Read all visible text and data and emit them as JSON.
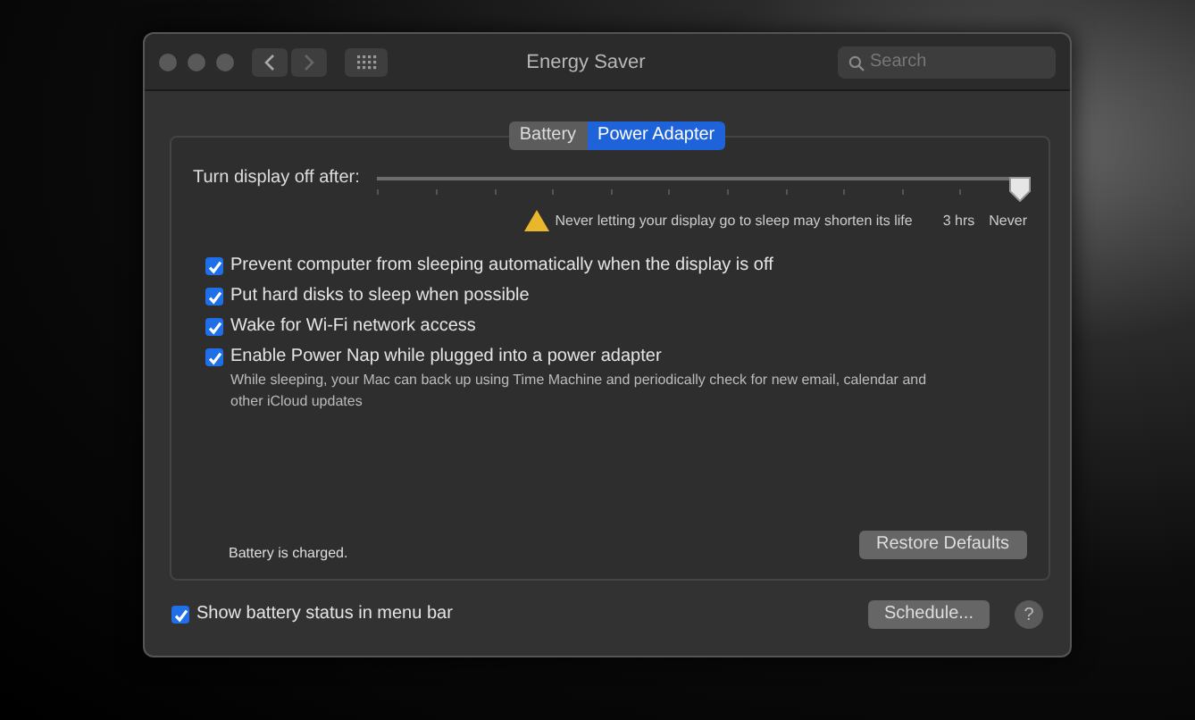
{
  "window": {
    "title": "Energy Saver",
    "search": {
      "placeholder": "Search"
    }
  },
  "tabs": [
    {
      "label": "Battery",
      "selected": false
    },
    {
      "label": "Power Adapter",
      "selected": true
    }
  ],
  "display_sleep": {
    "label": "Turn display off after:",
    "level": 1,
    "warning": "Never letting your display go to sleep may shorten its life",
    "tick_labels": [
      "3 hrs",
      "Never"
    ]
  },
  "options": [
    {
      "label": "Prevent computer from sleeping automatically when the display is off",
      "checked": true
    },
    {
      "label": "Put hard disks to sleep when possible",
      "checked": true
    },
    {
      "label": "Wake for Wi-Fi network access",
      "checked": true
    },
    {
      "label": "Enable Power Nap while plugged into a power adapter",
      "checked": true,
      "description": "While sleeping, your Mac can back up using Time Machine and periodically check for new email, calendar and other iCloud updates"
    }
  ],
  "status": "Battery is charged.",
  "restore_button": "Restore Defaults",
  "show_battery_status": {
    "label": "Show battery status in menu bar",
    "checked": true
  },
  "schedule_button": "Schedule...",
  "help_button": "?"
}
